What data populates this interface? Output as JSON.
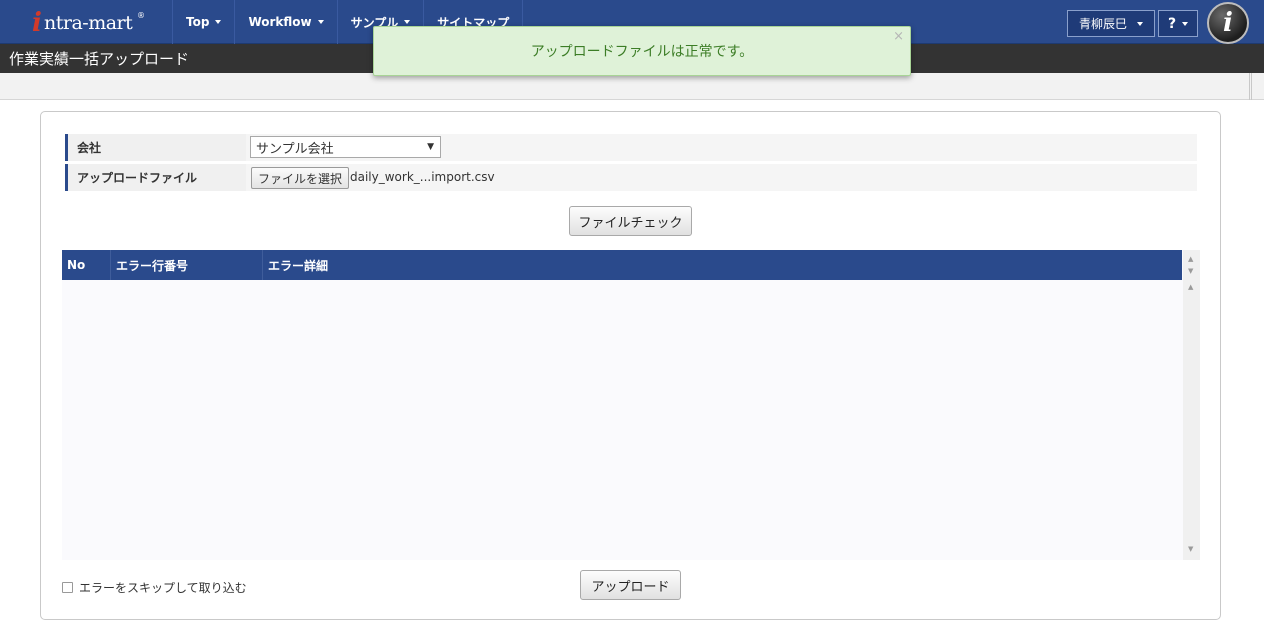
{
  "header": {
    "logo_i": "i",
    "logo_text": "ntra-mart",
    "logo_reg": "®",
    "nav": [
      {
        "label": "Top"
      },
      {
        "label": "Workflow"
      },
      {
        "label": "サンプル"
      },
      {
        "label": "サイトマップ"
      }
    ],
    "user_name": "青柳辰巳",
    "help_label": "?",
    "app_icon_letter": "i"
  },
  "page_title": "作業実績一括アップロード",
  "toast": {
    "message": "アップロードファイルは正常です。",
    "close": "×"
  },
  "form": {
    "company_label": "会社",
    "company_value": "サンプル会社",
    "company_arrow": "▼",
    "file_label": "アップロードファイル",
    "file_button": "ファイルを選択",
    "file_name": "daily_work_...import.csv"
  },
  "file_check_button": "ファイルチェック",
  "grid": {
    "columns": [
      "No",
      "エラー行番号",
      "エラー詳細"
    ],
    "scroll_up": "▲",
    "scroll_down": "▼"
  },
  "skip_label": "エラーをスキップして取り込む",
  "upload_button": "アップロード"
}
